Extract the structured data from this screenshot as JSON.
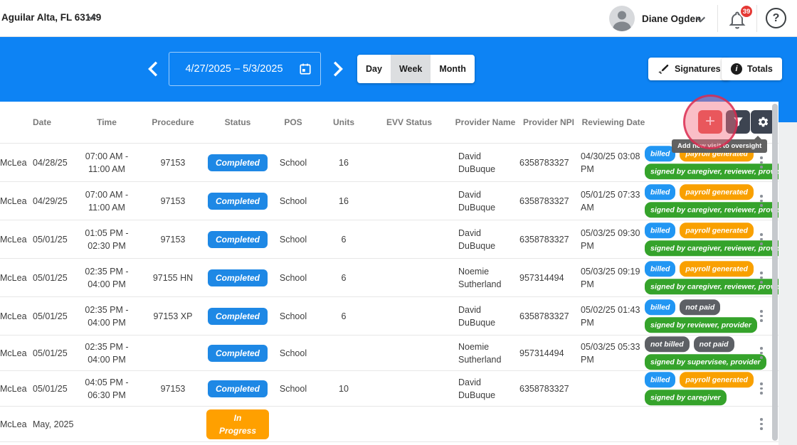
{
  "topbar": {
    "location": "Aguilar Alta, FL 63149",
    "user_name": "Diane Ogden",
    "notification_count": "39",
    "help_label": "?"
  },
  "toolbar": {
    "date_range": "4/27/2025 – 5/3/2025",
    "view_options": [
      "Day",
      "Week",
      "Month"
    ],
    "selected_view": "Week",
    "signatures_label": "Signatures",
    "totals_label": "Totals"
  },
  "tooltip": {
    "text": "Add new visit to oversight"
  },
  "header_buttons": {
    "plus": "+",
    "filter": "filter",
    "settings": "settings"
  },
  "table": {
    "headers": [
      "Date",
      "Time",
      "Procedure",
      "Status",
      "POS",
      "Units",
      "EVV Status",
      "Provider Name",
      "Provider NPI",
      "Reviewing Date"
    ],
    "rows": [
      {
        "client": "McLean",
        "date": "04/28/25",
        "time_lines": [
          "07:00 AM -",
          "11:00 AM"
        ],
        "procedure": "97153",
        "status": {
          "label": "Completed",
          "color": "blue"
        },
        "pos": "School",
        "units": "16",
        "evv": "",
        "provider": "David DuBuque",
        "npi": "6358783327",
        "review_lines": [
          "04/30/25 03:08",
          "PM"
        ],
        "badges_top": [
          {
            "label": "billed",
            "color": "blue"
          },
          {
            "label": "payroll generated",
            "color": "orange"
          }
        ],
        "badges_bottom": [
          {
            "label": "signed by caregiver, reviewer, provider",
            "color": "green"
          }
        ]
      },
      {
        "client": "McLean",
        "date": "04/29/25",
        "time_lines": [
          "07:00 AM -",
          "11:00 AM"
        ],
        "procedure": "97153",
        "status": {
          "label": "Completed",
          "color": "blue"
        },
        "pos": "School",
        "units": "16",
        "evv": "",
        "provider": "David DuBuque",
        "npi": "6358783327",
        "review_lines": [
          "05/01/25 07:33",
          "AM"
        ],
        "badges_top": [
          {
            "label": "billed",
            "color": "blue"
          },
          {
            "label": "payroll generated",
            "color": "orange"
          }
        ],
        "badges_bottom": [
          {
            "label": "signed by caregiver, reviewer, provider",
            "color": "green"
          }
        ]
      },
      {
        "client": "McLean",
        "date": "05/01/25",
        "time_lines": [
          "01:05 PM -",
          "02:30 PM"
        ],
        "procedure": "97153",
        "status": {
          "label": "Completed",
          "color": "blue"
        },
        "pos": "School",
        "units": "6",
        "evv": "",
        "provider": "David DuBuque",
        "npi": "6358783327",
        "review_lines": [
          "05/03/25 09:30",
          "PM"
        ],
        "badges_top": [
          {
            "label": "billed",
            "color": "blue"
          },
          {
            "label": "payroll generated",
            "color": "orange"
          }
        ],
        "badges_bottom": [
          {
            "label": "signed by caregiver, reviewer, provider",
            "color": "green"
          }
        ]
      },
      {
        "client": "McLean",
        "date": "05/01/25",
        "time_lines": [
          "02:35 PM -",
          "04:00 PM"
        ],
        "procedure": "97155 HN",
        "status": {
          "label": "Completed",
          "color": "blue"
        },
        "pos": "School",
        "units": "6",
        "evv": "",
        "provider": "Noemie Sutherland",
        "npi": "957314494",
        "review_lines": [
          "05/03/25 09:19",
          "PM"
        ],
        "badges_top": [
          {
            "label": "billed",
            "color": "blue"
          },
          {
            "label": "payroll generated",
            "color": "orange"
          }
        ],
        "badges_bottom": [
          {
            "label": "signed by caregiver, reviewer, provider",
            "color": "green"
          }
        ]
      },
      {
        "client": "McLean",
        "date": "05/01/25",
        "time_lines": [
          "02:35 PM -",
          "04:00 PM"
        ],
        "procedure": "97153 XP",
        "status": {
          "label": "Completed",
          "color": "blue"
        },
        "pos": "School",
        "units": "6",
        "evv": "",
        "provider": "David DuBuque",
        "npi": "6358783327",
        "review_lines": [
          "05/02/25 01:43",
          "PM"
        ],
        "badges_top": [
          {
            "label": "billed",
            "color": "blue"
          },
          {
            "label": "not paid",
            "color": "gray"
          }
        ],
        "badges_bottom": [
          {
            "label": "signed by reviewer, provider",
            "color": "green"
          }
        ]
      },
      {
        "client": "McLean",
        "date": "05/01/25",
        "time_lines": [
          "02:35 PM -",
          "04:00 PM"
        ],
        "procedure": "",
        "status": {
          "label": "Completed",
          "color": "blue"
        },
        "pos": "School",
        "units": "",
        "evv": "",
        "provider": "Noemie Sutherland",
        "npi": "957314494",
        "review_lines": [
          "05/03/25 05:33",
          "PM"
        ],
        "badges_top": [
          {
            "label": "not billed",
            "color": "gray"
          },
          {
            "label": "not paid",
            "color": "gray"
          }
        ],
        "badges_bottom": [
          {
            "label": "signed by supervisee, provider",
            "color": "green"
          }
        ]
      },
      {
        "client": "McLean",
        "date": "05/01/25",
        "time_lines": [
          "04:05 PM -",
          "06:30 PM"
        ],
        "procedure": "97153",
        "status": {
          "label": "Completed",
          "color": "blue"
        },
        "pos": "School",
        "units": "10",
        "evv": "",
        "provider": "David DuBuque",
        "npi": "6358783327",
        "review_lines": [],
        "badges_top": [
          {
            "label": "billed",
            "color": "blue"
          },
          {
            "label": "payroll generated",
            "color": "orange"
          }
        ],
        "badges_bottom": [
          {
            "label": "signed by caregiver",
            "color": "green"
          }
        ]
      },
      {
        "client": "McLean",
        "date": "May, 2025",
        "time_lines": [],
        "procedure": "",
        "status": {
          "label": "In Progress",
          "color": "orange"
        },
        "pos": "",
        "units": "",
        "evv": "",
        "provider": "",
        "npi": "",
        "review_lines": [],
        "badges_top": [],
        "badges_bottom": []
      }
    ]
  },
  "colors": {
    "band_blue": "#0d83f4",
    "status_completed": "#1e88e5",
    "status_in_progress": "#ffa000",
    "badge_billed": "#2196f3",
    "badge_payroll": "#f9a000",
    "badge_signed": "#35a32b",
    "badge_not_paid": "#5d6065",
    "alert_red": "#e53935",
    "highlight_ring": "#d8244a",
    "dark_button": "#3d4451"
  }
}
